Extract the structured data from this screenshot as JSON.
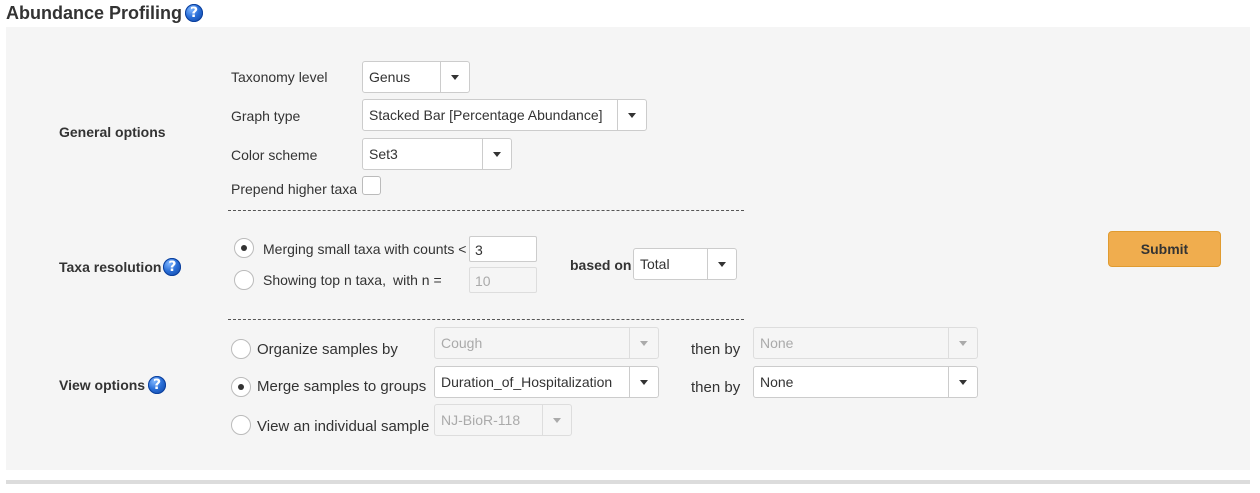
{
  "page": {
    "title": "Abundance Profiling",
    "help_icon": "question-circle-icon"
  },
  "general_options": {
    "label": "General options",
    "taxonomy_level": {
      "label": "Taxonomy level",
      "value": "Genus"
    },
    "graph_type": {
      "label": "Graph type",
      "value": "Stacked Bar [Percentage Abundance]"
    },
    "color_scheme": {
      "label": "Color scheme",
      "value": "Set3"
    },
    "prepend_higher_taxa": {
      "label": "Prepend higher taxa",
      "checked": false
    }
  },
  "taxa_resolution": {
    "label": "Taxa resolution",
    "merging": {
      "label": "Merging small taxa with counts <",
      "value": "3",
      "selected": true
    },
    "top_n": {
      "label": "Showing top n taxa,",
      "with_n_label": "with n =",
      "value": "10",
      "selected": false
    },
    "based_on": {
      "label": "based on",
      "value": "Total"
    }
  },
  "view_options": {
    "label": "View options",
    "organize": {
      "label": "Organize samples by",
      "value": "Cough",
      "then_by_label": "then by",
      "then_by_value": "None",
      "selected": false
    },
    "merge": {
      "label": "Merge samples to groups",
      "value": "Duration_of_Hospitalization",
      "then_by_label": "then by",
      "then_by_value": "None",
      "selected": true
    },
    "individual": {
      "label": "View an individual sample",
      "value": "NJ-BioR-118",
      "selected": false
    }
  },
  "submit": {
    "label": "Submit",
    "color": "#f0ad4e"
  }
}
